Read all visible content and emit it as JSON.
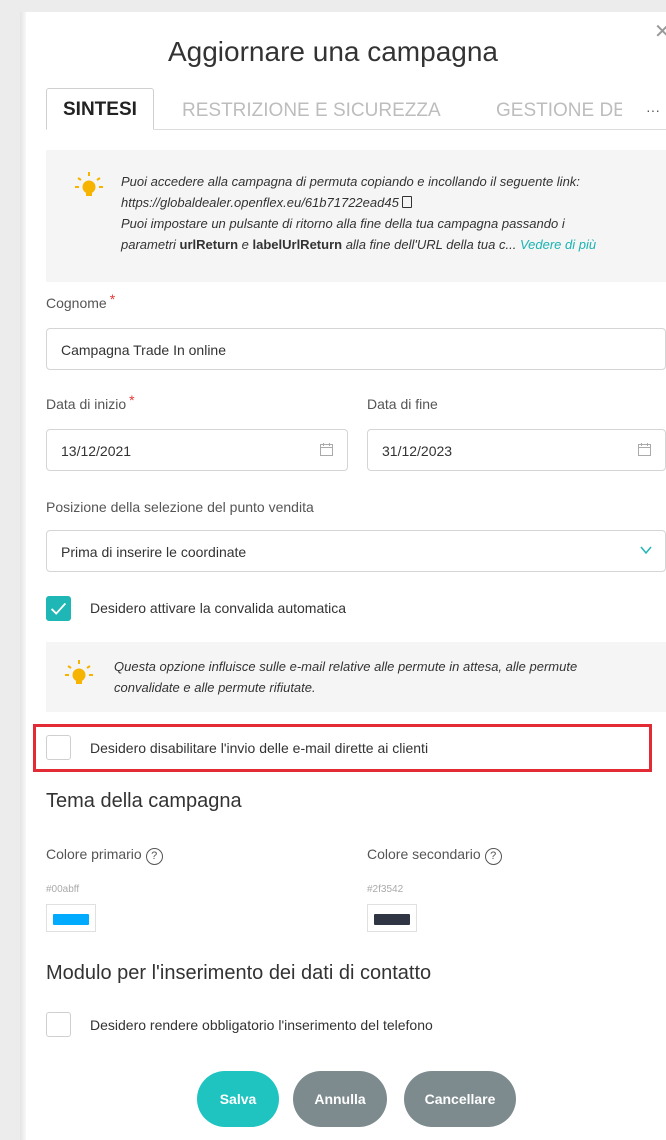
{
  "modal": {
    "title": "Aggiornare una campagna",
    "close_icon": "close-icon"
  },
  "tabs": [
    {
      "label": "SINTESI",
      "active": true
    },
    {
      "label": "RESTRIZIONE E SICUREZZA",
      "active": false
    },
    {
      "label": "GESTIONE DEI",
      "active": false
    }
  ],
  "tabs_more": "···",
  "info_link": {
    "line1": "Puoi accedere alla campagna di permuta copiando e incollando il seguente link:",
    "url": "https://globaldealer.openflex.eu/61b71722ead45",
    "line3": "Puoi impostare un pulsante di ritorno alla fine della tua campagna passando i",
    "line4_pre": "parametri ",
    "param1": "urlReturn",
    "line4_mid": " e ",
    "param2": "labelUrlReturn",
    "line4_post": " alla fine dell'URL della tua c...",
    "see_more": "Vedere di più"
  },
  "form": {
    "name_label": "Cognome",
    "name_value": "Campagna Trade In online",
    "start_label": "Data di inizio",
    "start_value": "13/12/2021",
    "end_label": "Data di fine",
    "end_value": "31/12/2023",
    "position_label": "Posizione della selezione del punto vendita",
    "position_value": "Prima di inserire le coordinate",
    "required_mark": "*"
  },
  "checkboxes": {
    "auto_validation": {
      "label": "Desidero attivare la convalida automatica",
      "checked": true
    },
    "disable_emails": {
      "label": "Desidero disabilitare l'invio delle e-mail dirette ai clienti",
      "checked": false
    },
    "phone_required": {
      "label": "Desidero rendere obbligatorio l'inserimento del telefono",
      "checked": false
    }
  },
  "info_validation": {
    "line1": "Questa opzione influisce sulle e-mail relative alle permute in attesa, alle permute",
    "line2": "convalidate e alle permute rifiutate."
  },
  "theme": {
    "title": "Tema della campagna",
    "primary_label": "Colore primario",
    "primary_hex": "#00abff",
    "secondary_label": "Colore secondario",
    "secondary_hex": "#2f3542",
    "help_glyph": "?"
  },
  "contact": {
    "title": "Modulo per l'inserimento dei dati di contatto"
  },
  "buttons": {
    "save": "Salva",
    "cancel": "Annulla",
    "delete": "Cancellare"
  },
  "colors": {
    "accent": "#1fb6b6",
    "highlight": "#e32b35",
    "secondary_button": "#7d8b8e"
  }
}
